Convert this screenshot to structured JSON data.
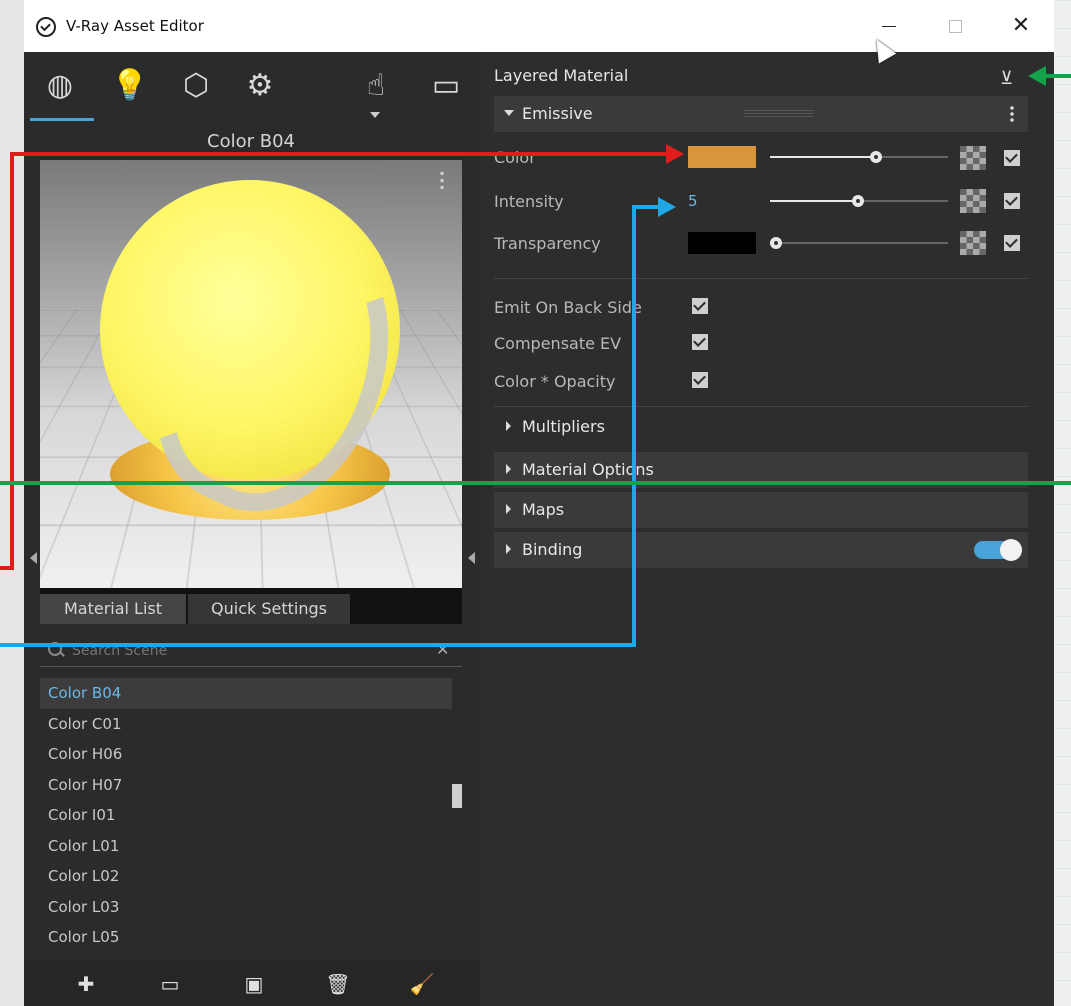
{
  "window": {
    "title": "V-Ray Asset Editor"
  },
  "left": {
    "preview_title": "Color B04",
    "tabs": [
      "Material List",
      "Quick Settings"
    ],
    "search_placeholder": "Search Scene",
    "materials": [
      "Color B04",
      "Color C01",
      "Color H06",
      "Color H07",
      "Color I01",
      "Color L01",
      "Color L02",
      "Color L03",
      "Color L05"
    ],
    "selected_index": 0
  },
  "right": {
    "header": "Layered Material",
    "section_emissive": "Emissive",
    "props": {
      "color": "Color",
      "intensity": "Intensity",
      "intensity_value": "5",
      "transparency": "Transparency",
      "emit_back": "Emit On Back Side",
      "compensate": "Compensate EV",
      "color_opacity": "Color * Opacity"
    },
    "sections": [
      "Multipliers",
      "Material Options",
      "Maps",
      "Binding"
    ]
  },
  "colors": {
    "emissive_color": "#d9953a",
    "transparency_color": "#000000",
    "accent": "#4aa3d8",
    "arrow_red": "#e21b1b",
    "arrow_blue": "#1fa8e6",
    "arrow_green": "#13a34a"
  }
}
